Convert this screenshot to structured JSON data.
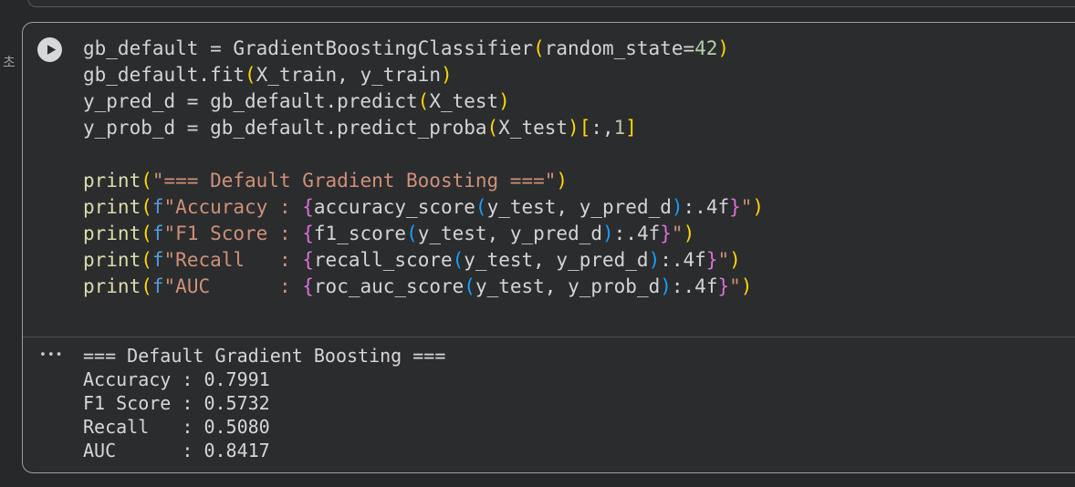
{
  "page": {
    "background": "#27282a"
  },
  "gutter": {
    "execution_time_unit_label": "초"
  },
  "cell": {
    "run_button": {
      "icon": "play-icon"
    },
    "code": {
      "lines": [
        [
          {
            "t": "w",
            "s": "gb_default = GradientBoostingClassifier"
          },
          {
            "t": "b1",
            "s": "("
          },
          {
            "t": "w",
            "s": "random_state="
          },
          {
            "t": "num",
            "s": "42"
          },
          {
            "t": "b1",
            "s": ")"
          }
        ],
        [
          {
            "t": "w",
            "s": "gb_default.fit"
          },
          {
            "t": "b1",
            "s": "("
          },
          {
            "t": "w",
            "s": "X_train, y_train"
          },
          {
            "t": "b1",
            "s": ")"
          }
        ],
        [
          {
            "t": "w",
            "s": "y_pred_d = gb_default.predict"
          },
          {
            "t": "b1",
            "s": "("
          },
          {
            "t": "w",
            "s": "X_test"
          },
          {
            "t": "b1",
            "s": ")"
          }
        ],
        [
          {
            "t": "w",
            "s": "y_prob_d = gb_default.predict_proba"
          },
          {
            "t": "b1",
            "s": "("
          },
          {
            "t": "w",
            "s": "X_test"
          },
          {
            "t": "b1",
            "s": ")"
          },
          {
            "t": "b1",
            "s": "["
          },
          {
            "t": "w",
            "s": ":,"
          },
          {
            "t": "num",
            "s": "1"
          },
          {
            "t": "b1",
            "s": "]"
          }
        ],
        [],
        [
          {
            "t": "fn",
            "s": "print"
          },
          {
            "t": "b1",
            "s": "("
          },
          {
            "t": "str",
            "s": "\"=== Default Gradient Boosting ===\""
          },
          {
            "t": "b1",
            "s": ")"
          }
        ],
        [
          {
            "t": "fn",
            "s": "print"
          },
          {
            "t": "b1",
            "s": "("
          },
          {
            "t": "kw",
            "s": "f"
          },
          {
            "t": "str",
            "s": "\"Accuracy : "
          },
          {
            "t": "b2",
            "s": "{"
          },
          {
            "t": "w",
            "s": "accuracy_score"
          },
          {
            "t": "b3",
            "s": "("
          },
          {
            "t": "w",
            "s": "y_test, y_pred_d"
          },
          {
            "t": "b3",
            "s": ")"
          },
          {
            "t": "w",
            "s": ":.4f"
          },
          {
            "t": "b2",
            "s": "}"
          },
          {
            "t": "str",
            "s": "\""
          },
          {
            "t": "b1",
            "s": ")"
          }
        ],
        [
          {
            "t": "fn",
            "s": "print"
          },
          {
            "t": "b1",
            "s": "("
          },
          {
            "t": "kw",
            "s": "f"
          },
          {
            "t": "str",
            "s": "\"F1 Score : "
          },
          {
            "t": "b2",
            "s": "{"
          },
          {
            "t": "w",
            "s": "f1_score"
          },
          {
            "t": "b3",
            "s": "("
          },
          {
            "t": "w",
            "s": "y_test, y_pred_d"
          },
          {
            "t": "b3",
            "s": ")"
          },
          {
            "t": "w",
            "s": ":.4f"
          },
          {
            "t": "b2",
            "s": "}"
          },
          {
            "t": "str",
            "s": "\""
          },
          {
            "t": "b1",
            "s": ")"
          }
        ],
        [
          {
            "t": "fn",
            "s": "print"
          },
          {
            "t": "b1",
            "s": "("
          },
          {
            "t": "kw",
            "s": "f"
          },
          {
            "t": "str",
            "s": "\"Recall   : "
          },
          {
            "t": "b2",
            "s": "{"
          },
          {
            "t": "w",
            "s": "recall_score"
          },
          {
            "t": "b3",
            "s": "("
          },
          {
            "t": "w",
            "s": "y_test, y_pred_d"
          },
          {
            "t": "b3",
            "s": ")"
          },
          {
            "t": "w",
            "s": ":.4f"
          },
          {
            "t": "b2",
            "s": "}"
          },
          {
            "t": "str",
            "s": "\""
          },
          {
            "t": "b1",
            "s": ")"
          }
        ],
        [
          {
            "t": "fn",
            "s": "print"
          },
          {
            "t": "b1",
            "s": "("
          },
          {
            "t": "kw",
            "s": "f"
          },
          {
            "t": "str",
            "s": "\"AUC      : "
          },
          {
            "t": "b2",
            "s": "{"
          },
          {
            "t": "w",
            "s": "roc_auc_score"
          },
          {
            "t": "b3",
            "s": "("
          },
          {
            "t": "w",
            "s": "y_test, y_prob_d"
          },
          {
            "t": "b3",
            "s": ")"
          },
          {
            "t": "w",
            "s": ":.4f"
          },
          {
            "t": "b2",
            "s": "}"
          },
          {
            "t": "str",
            "s": "\""
          },
          {
            "t": "b1",
            "s": ")"
          }
        ]
      ]
    },
    "output": {
      "collapse_indicator": "•••",
      "lines": [
        "=== Default Gradient Boosting ===",
        "Accuracy : 0.7991",
        "F1 Score : 0.5732",
        "Recall   : 0.5080",
        "AUC      : 0.8417"
      ]
    }
  },
  "colors": {
    "page_bg": "#27282a",
    "cell_bg": "#2b2c2e",
    "cell_border_focused": "#9aa0a6",
    "cell_border_unfocused": "#55585c",
    "code_default": "#d4d4d4",
    "code_function": "#dcdcaa",
    "code_string": "#ce9178",
    "code_number": "#b5cea8",
    "code_keyword": "#569cd6",
    "bracket_level1": "#ffd700",
    "bracket_level2": "#da70d6",
    "bracket_level3": "#179fff",
    "output_text": "#d6d6d6"
  }
}
